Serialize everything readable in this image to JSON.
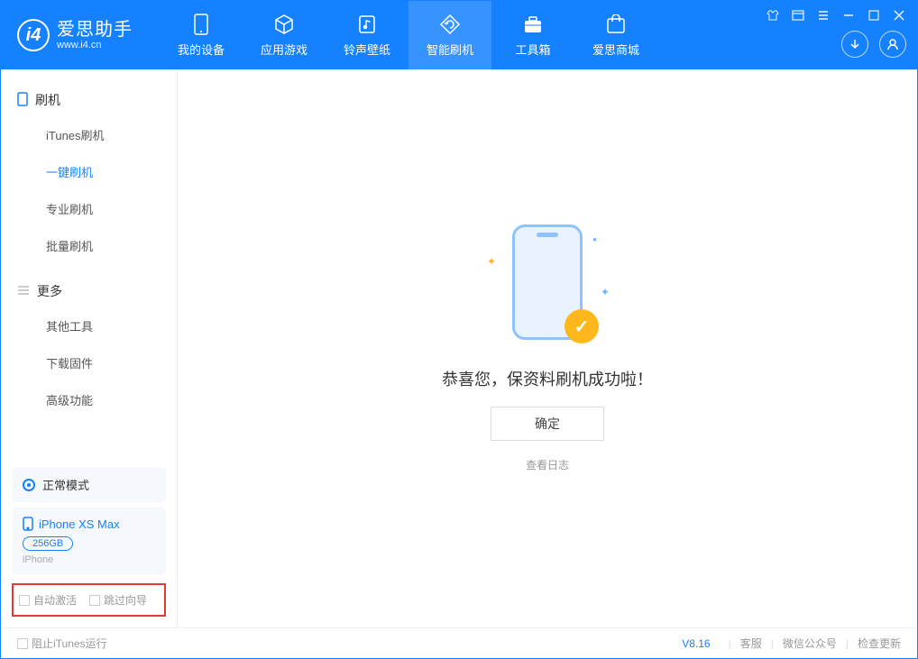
{
  "logo": {
    "title": "爱思助手",
    "url": "www.i4.cn"
  },
  "nav": {
    "tabs": [
      {
        "label": "我的设备"
      },
      {
        "label": "应用游戏"
      },
      {
        "label": "铃声壁纸"
      },
      {
        "label": "智能刷机"
      },
      {
        "label": "工具箱"
      },
      {
        "label": "爱思商城"
      }
    ]
  },
  "sidebar": {
    "section1": "刷机",
    "items1": [
      "iTunes刷机",
      "一键刷机",
      "专业刷机",
      "批量刷机"
    ],
    "section2": "更多",
    "items2": [
      "其他工具",
      "下载固件",
      "高级功能"
    ]
  },
  "mode": {
    "label": "正常模式"
  },
  "device": {
    "name": "iPhone XS Max",
    "capacity": "256GB",
    "type": "iPhone"
  },
  "checkboxes": {
    "auto_activate": "自动激活",
    "skip_guide": "跳过向导"
  },
  "main": {
    "success_msg": "恭喜您，保资料刷机成功啦！",
    "ok": "确定",
    "view_log": "查看日志"
  },
  "status": {
    "block_itunes": "阻止iTunes运行",
    "version": "V8.16",
    "support": "客服",
    "wechat": "微信公众号",
    "check_update": "检查更新"
  }
}
